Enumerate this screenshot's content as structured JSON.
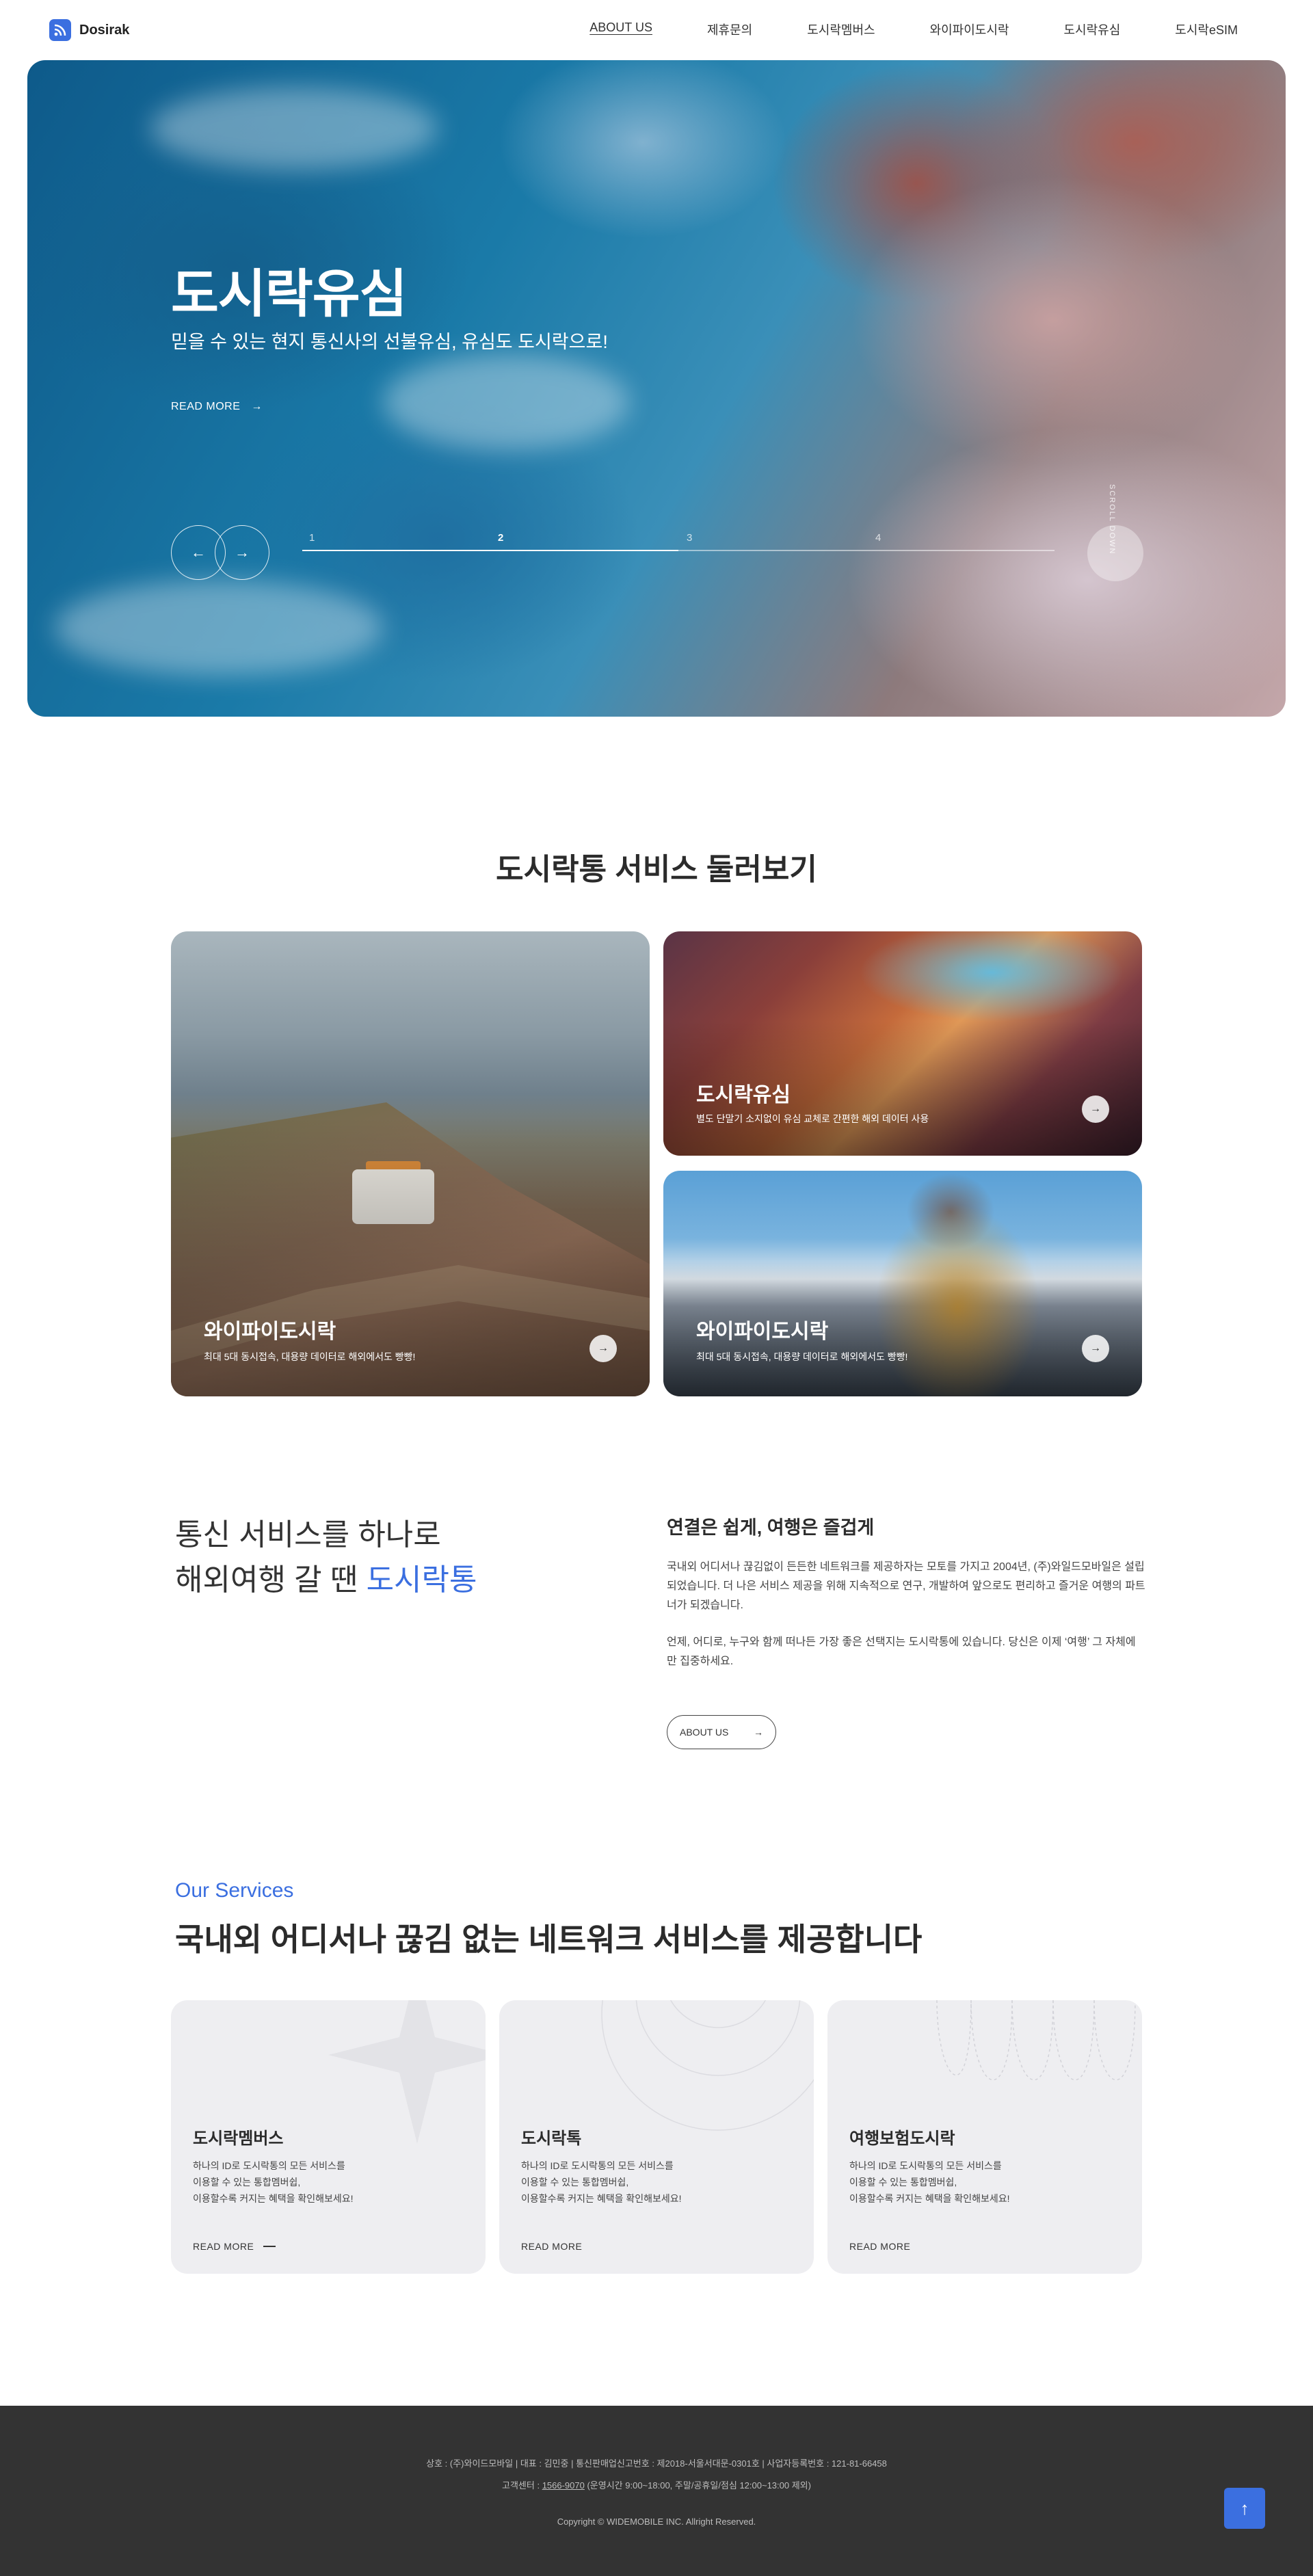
{
  "header": {
    "logo_text": "Dosirak",
    "nav": [
      {
        "label": "ABOUT US"
      },
      {
        "label": "제휴문의"
      },
      {
        "label": "도시락멤버스"
      },
      {
        "label": "와이파이도시락"
      },
      {
        "label": "도시락유심"
      },
      {
        "label": "도시락eSIM"
      }
    ]
  },
  "hero": {
    "title": "도시락유심",
    "subtitle": "믿을 수 있는 현지 통신사의 선불유심, 유심도 도시락으로!",
    "read_more": "READ MORE",
    "slides": [
      "1",
      "2",
      "3",
      "4"
    ],
    "current_slide": 2,
    "progress": 0.5,
    "vertical_text": "SCROLL DOWN"
  },
  "overview": {
    "title": "도시락통 서비스 둘러보기",
    "cards": [
      {
        "title": "와이파이도시락",
        "desc": "최대 5대 동시접속, 대용량 데이터로 해외에서도 빵빵!"
      },
      {
        "title": "도시락유심",
        "desc": "별도 단말기 소지없이 유심 교체로  간편한 해외 데이터 사용"
      },
      {
        "title": "와이파이도시락",
        "desc": "최대 5대 동시접속, 대용량 데이터로 해외에서도 빵빵!"
      }
    ]
  },
  "about": {
    "line1": "통신 서비스를 하나로",
    "line2_prefix": "해외여행 갈 땐 ",
    "line2_highlight": "도시락통",
    "heading": "연결은 쉽게, 여행은 즐겁게",
    "para1": "국내외 어디서나 끊김없이 든든한 네트워크를 제공하자는 모토를 가지고 2004년, (주)와일드모바일은 설립되었습니다. 더 나은 서비스 제공을 위해 지속적으로 연구, 개발하여 앞으로도 편리하고 즐거운 여행의 파트너가 되겠습니다.",
    "para2": "언제, 어디로, 누구와 함께 떠나든 가장 좋은 선택지는 도시락통에 있습니다. 당신은 이제 ‘여행’ 그 자체에만 집중하세요.",
    "button": "ABOUT US"
  },
  "services": {
    "eyebrow": "Our Services",
    "title": "국내외 어디서나 끊김 없는 네트워크 서비스를 제공합니다",
    "cards": [
      {
        "title": "도시락멤버스",
        "lines": [
          "하나의 ID로 도시락통의 모든 서비스를",
          "이용할 수 있는 통합멤버쉽,",
          "이용할수록 커지는 혜택을 확인해보세요!"
        ],
        "more": "READ MORE"
      },
      {
        "title": "도시락톡",
        "lines": [
          "하나의 ID로 도시락통의 모든 서비스를",
          "이용할 수 있는 통합멤버쉽,",
          "이용할수록 커지는 혜택을 확인해보세요!"
        ],
        "more": "READ MORE"
      },
      {
        "title": "여행보험도시락",
        "lines": [
          "하나의 ID로 도시락통의 모든 서비스를",
          "이용할 수 있는 통합멤버쉽,",
          "이용할수록 커지는 혜택을 확인해보세요!"
        ],
        "more": "READ MORE"
      }
    ]
  },
  "footer": {
    "line1": "상호 : (주)와이드모바일  |  대표 : 김민중  |  통신판매업신고번호 : 제2018-서울서대문-0301호  |  사업자등록번호 : 121-81-66458",
    "line2_prefix": "고객센터 : ",
    "phone": "1566-9070",
    "line2_suffix": " (운영시간 9:00~18:00, 주말/공휴일/점심 12:00~13:00 제외)",
    "copyright": "Copyright © WIDEMOBILE INC. Allright Reserved."
  },
  "colors": {
    "accent": "#3b6fe0",
    "footer_bg": "#333333",
    "card_bg": "#eeeef1"
  }
}
